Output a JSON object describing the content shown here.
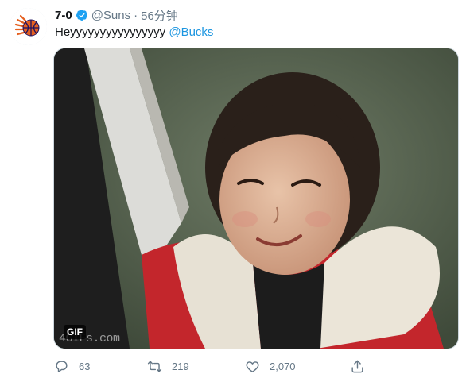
{
  "tweet": {
    "display_name": "7-0",
    "handle": "@Suns",
    "separator": "·",
    "time": "56分钟",
    "text": "Heyyyyyyyyyyyyyyyy",
    "mention": "@Bucks",
    "media": {
      "badge": "GIF",
      "watermark": "4GIFs.com"
    },
    "actions": {
      "replies": "63",
      "retweets": "219",
      "likes": "2,070"
    }
  },
  "colors": {
    "accent": "#1b95e0",
    "secondary_text": "#657786",
    "suns_orange": "#e56020",
    "suns_purple": "#1d1160"
  },
  "icons": {
    "avatar": "suns-logo-icon",
    "verified": "verified-badge-icon",
    "reply": "reply-icon",
    "retweet": "retweet-icon",
    "like": "heart-icon",
    "share": "share-icon"
  }
}
